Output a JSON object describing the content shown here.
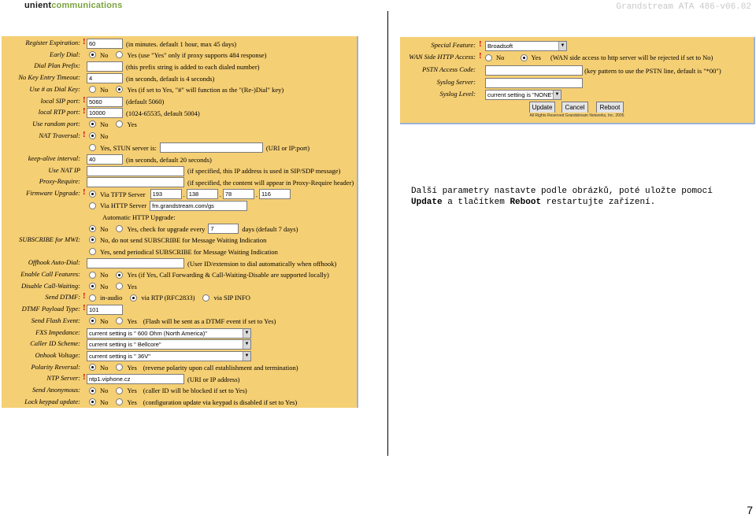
{
  "header": {
    "logo_part1": "unient",
    "logo_part2": "communications",
    "doc_title": "Grandstream ATA 486-v06.02",
    "page_number": "7"
  },
  "left_form": [
    {
      "label": "Register Expiration:",
      "required": true,
      "input": "60",
      "text": "(in minutes. default 1 hour, max 45 days)"
    },
    {
      "label": "Early Dial:",
      "radios": [
        {
          "t": "No",
          "on": true
        },
        {
          "t": "Yes (use \"Yes\" only if proxy supports 484 response)",
          "on": false
        }
      ]
    },
    {
      "label": "Dial Plan Prefix:",
      "input": "",
      "text": "(this prefix string is added to each dialed number)"
    },
    {
      "label": "No Key Entry Timeout:",
      "input": "4",
      "text": "(in seconds, default is 4 seconds)"
    },
    {
      "label": "Use # as Dial Key:",
      "radios": [
        {
          "t": "No",
          "on": false
        },
        {
          "t": "Yes (if set to Yes, \"#\" will function as the \"(Re-)Dial\" key)",
          "on": true
        }
      ]
    },
    {
      "label": "local SIP port:",
      "required": true,
      "input": "5060",
      "text": "(default 5060)"
    },
    {
      "label": "local RTP port:",
      "required": true,
      "input": "10000",
      "text": "(1024-65535, default 5004)"
    },
    {
      "label": "Use random port:",
      "radios": [
        {
          "t": "No",
          "on": true
        },
        {
          "t": "Yes",
          "on": false
        }
      ]
    },
    {
      "label": "NAT Traversal:",
      "required": true,
      "radios": [
        {
          "t": "No",
          "on": true
        }
      ]
    },
    {
      "label": "",
      "radios": [
        {
          "t": "Yes, STUN server is:",
          "on": false
        }
      ],
      "input2": "",
      "text2": "(URI or IP:port)"
    },
    {
      "label": "keep-alive interval:",
      "input": "40",
      "text": "(in seconds, default 20 seconds)"
    },
    {
      "label": "Use NAT IP",
      "input": "",
      "text": "(if specified, this IP address is used in SIP/SDP message)"
    },
    {
      "label": "Proxy-Require:",
      "input": "",
      "text": "(if specified, the content will appear in Proxy-Require header)"
    },
    {
      "label": "Firmware Upgrade:",
      "required": true,
      "radios": [
        {
          "t": "Via TFTP Server",
          "on": true
        }
      ],
      "ip": [
        "193",
        "138",
        "78",
        "116"
      ]
    },
    {
      "label": "",
      "radios": [
        {
          "t": "Via HTTP Server",
          "on": false
        }
      ],
      "input2": "fm.grandstream.com/gs"
    },
    {
      "label": "",
      "text": "Automatic HTTP Upgrade:"
    },
    {
      "label": "",
      "radios": [
        {
          "t": "No",
          "on": true
        },
        {
          "t": "Yes, check for upgrade every",
          "on": false
        }
      ],
      "input2": "7",
      "text2": "days (default 7 days)"
    },
    {
      "label": "SUBSCRIBE for MWI:",
      "radios": [
        {
          "t": "No, do not send SUBSCRIBE for Message Waiting Indication",
          "on": true
        }
      ]
    },
    {
      "label": "",
      "radios": [
        {
          "t": "Yes, send periodical SUBSCRIBE for Message Waiting Indication",
          "on": false
        }
      ]
    },
    {
      "label": "Offhook Auto-Dial:",
      "input": "",
      "text": "(User ID/extension to dial automatically when offhook)"
    },
    {
      "label": "Enable Call Features:",
      "radios": [
        {
          "t": "No",
          "on": false
        },
        {
          "t": "Yes (if Yes, Call Forwarding & Call-Waiting-Disable are supported locally)",
          "on": true
        }
      ]
    },
    {
      "label": "Disable Call-Waiting:",
      "radios": [
        {
          "t": "No",
          "on": true
        },
        {
          "t": "Yes",
          "on": false
        }
      ]
    },
    {
      "label": "Send DTMF:",
      "required": true,
      "radios": [
        {
          "t": "in-audio",
          "on": false
        },
        {
          "t": "via RTP (RFC2833)",
          "on": true
        },
        {
          "t": "via SIP INFO",
          "on": false
        }
      ]
    },
    {
      "label": "DTMF Payload Type:",
      "required": true,
      "input": "101"
    },
    {
      "label": "Send Flash Event:",
      "radios": [
        {
          "t": "No",
          "on": true
        },
        {
          "t": "Yes",
          "on": false
        }
      ],
      "text": "(Flash will be sent as a DTMF event if set to Yes)"
    },
    {
      "label": "FXS Impedance:",
      "select": "current setting is \" 600 Ohm (North America)\""
    },
    {
      "label": "Caller ID Scheme:",
      "select": "current setting is \" Bellcore\""
    },
    {
      "label": "Onhook Voltage:",
      "select": "current setting is \" 36V\""
    },
    {
      "label": "Polarity Reversal:",
      "radios": [
        {
          "t": "No",
          "on": true
        },
        {
          "t": "Yes",
          "on": false
        }
      ],
      "text": "(reverse polarity upon call establishment and termination)"
    },
    {
      "label": "NTP Server:",
      "required": true,
      "input": "ntp1.viphone.cz",
      "text": "(URI or IP address)"
    },
    {
      "label": "Send Anonymous:",
      "radios": [
        {
          "t": "No",
          "on": true
        },
        {
          "t": "Yes",
          "on": false
        }
      ],
      "text": "(caller ID will be blocked if set to Yes)"
    },
    {
      "label": "Lock keypad update:",
      "radios": [
        {
          "t": "No",
          "on": true
        },
        {
          "t": "Yes",
          "on": false
        }
      ],
      "text": "(configuration update via keypad is disabled if set to Yes)"
    }
  ],
  "right_form": {
    "special_feature_label": "Special Feature:",
    "special_feature_value": "Broadsoft",
    "wan_label": "WAN Side HTTP Access:",
    "wan_no": "No",
    "wan_yes": "Yes",
    "wan_note": "(WAN side access to http server will be rejected if set to No)",
    "pstn_label": "PSTN Access Code:",
    "pstn_note": "(key pattern to use the PSTN line, default is \"*00\")",
    "syslog_server_label": "Syslog Server:",
    "syslog_level_label": "Syslog Level:",
    "syslog_level_value": "current setting is \"NONE\"",
    "btn_update": "Update",
    "btn_cancel": "Cancel",
    "btn_reboot": "Reboot",
    "footer": "All Rights Reserved Grandstream Networks, Inc. 2005"
  },
  "note": {
    "line1": "Další parametry nastavte podle obrázků, poté uložte pomocí",
    "update_word": "Update",
    "mid": " a tlačítkem ",
    "reboot_word": "Reboot",
    "end": " restartujte zařízení."
  },
  "colors": {
    "panel": "#f5cf74",
    "required": "#e00000",
    "logo_green": "#7ba23f"
  }
}
